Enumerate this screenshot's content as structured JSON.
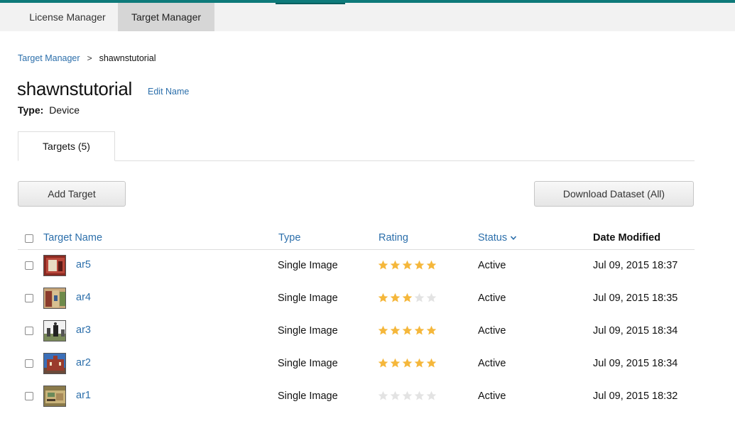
{
  "topnav": {
    "items": [
      {
        "label": "License Manager"
      },
      {
        "label": "Target Manager"
      }
    ]
  },
  "breadcrumb": {
    "link": "Target Manager",
    "separator": ">",
    "current": "shawnstutorial"
  },
  "database": {
    "name": "shawnstutorial",
    "edit_label": "Edit Name",
    "type_label": "Type:",
    "type_value": "Device"
  },
  "tabs": [
    {
      "label": "Targets (5)"
    }
  ],
  "toolbar": {
    "add_label": "Add Target",
    "download_label": "Download Dataset (All)"
  },
  "table": {
    "columns": {
      "name": "Target Name",
      "type": "Type",
      "rating": "Rating",
      "status": "Status",
      "date": "Date Modified"
    },
    "rows": [
      {
        "name": "ar5",
        "type": "Single Image",
        "rating": 5,
        "status": "Active",
        "date": "Jul 09, 2015 18:37",
        "thumb": "thumb-1"
      },
      {
        "name": "ar4",
        "type": "Single Image",
        "rating": 3,
        "status": "Active",
        "date": "Jul 09, 2015 18:35",
        "thumb": "thumb-2"
      },
      {
        "name": "ar3",
        "type": "Single Image",
        "rating": 5,
        "status": "Active",
        "date": "Jul 09, 2015 18:34",
        "thumb": "thumb-3"
      },
      {
        "name": "ar2",
        "type": "Single Image",
        "rating": 5,
        "status": "Active",
        "date": "Jul 09, 2015 18:34",
        "thumb": "thumb-4"
      },
      {
        "name": "ar1",
        "type": "Single Image",
        "rating": 0,
        "status": "Active",
        "date": "Jul 09, 2015 18:32",
        "thumb": "thumb-5"
      }
    ]
  },
  "colors": {
    "accent": "#0e7a7a",
    "link": "#2c6fab",
    "star_on": "#f5b73b",
    "star_off": "#e3e3e3"
  }
}
